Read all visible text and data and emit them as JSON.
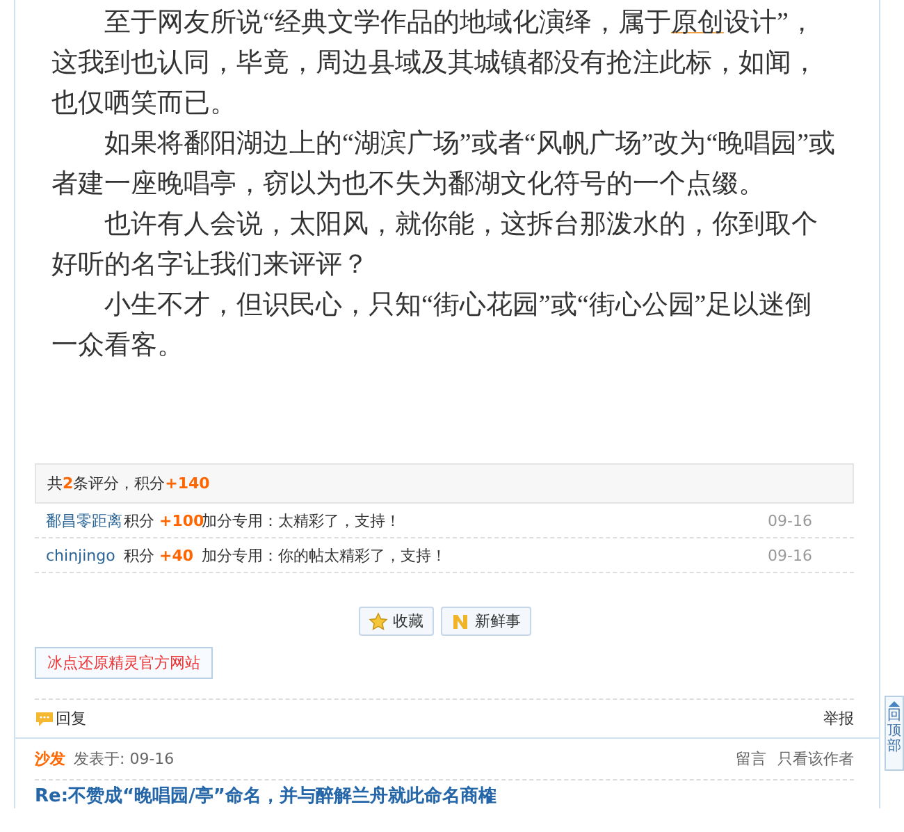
{
  "article": {
    "paragraphs": [
      {
        "parts": [
          {
            "text": "至于网友所说“经典文学作品的地域化演绎，属于"
          },
          {
            "text": "原创",
            "link": true
          },
          {
            "text": "设计”，这我到也认同，毕竟，周边县域及其城镇都没有抢注此标，如闻，也仅哂笑而已。"
          }
        ]
      },
      {
        "parts": [
          {
            "text": "如果将鄱阳湖边上的“湖滨广场”或者“风帆广场”改为“晚唱园”或者建一座晚唱亭，窃以为也不失为鄱湖文化符号的一个点缀。"
          }
        ]
      },
      {
        "parts": [
          {
            "text": "也许有人会说，太阳风，就你能，这拆台那泼水的，你到取个好听的名字让我们来评评？"
          }
        ]
      },
      {
        "parts": [
          {
            "text": "小生不才，但识民心，只知“街心花园”或“街心公园”足以迷倒一众看客。"
          }
        ]
      }
    ]
  },
  "ratings": {
    "summary": "共**2**条评分，积分**+140**",
    "rows": [
      {
        "user": "鄱昌零距离",
        "points_label": "积分",
        "points": "+100",
        "comment": "加分专用：太精彩了，支持！",
        "date": "09-16"
      },
      {
        "user": "chinjingo",
        "points_label": "积分",
        "points": "+40",
        "comment": "加分专用：你的帖太精彩了，支持！",
        "date": "09-16"
      }
    ]
  },
  "actions": [
    {
      "kind": "star",
      "label": "收藏"
    },
    {
      "kind": "news",
      "label": "新鲜事"
    }
  ],
  "ad_link": "冰点还原精灵官方网站",
  "reply_bar": {
    "reply": "回复",
    "report": "举报"
  },
  "next_post": {
    "author": "沙发",
    "posted": "发表于: 09-16",
    "links": [
      "留言",
      "只看该作者"
    ],
    "title": "Re:不赞成“晚唱园/亭”命名，并与醉解兰舟就此命名商榷"
  },
  "back_to_top": "回顶部"
}
